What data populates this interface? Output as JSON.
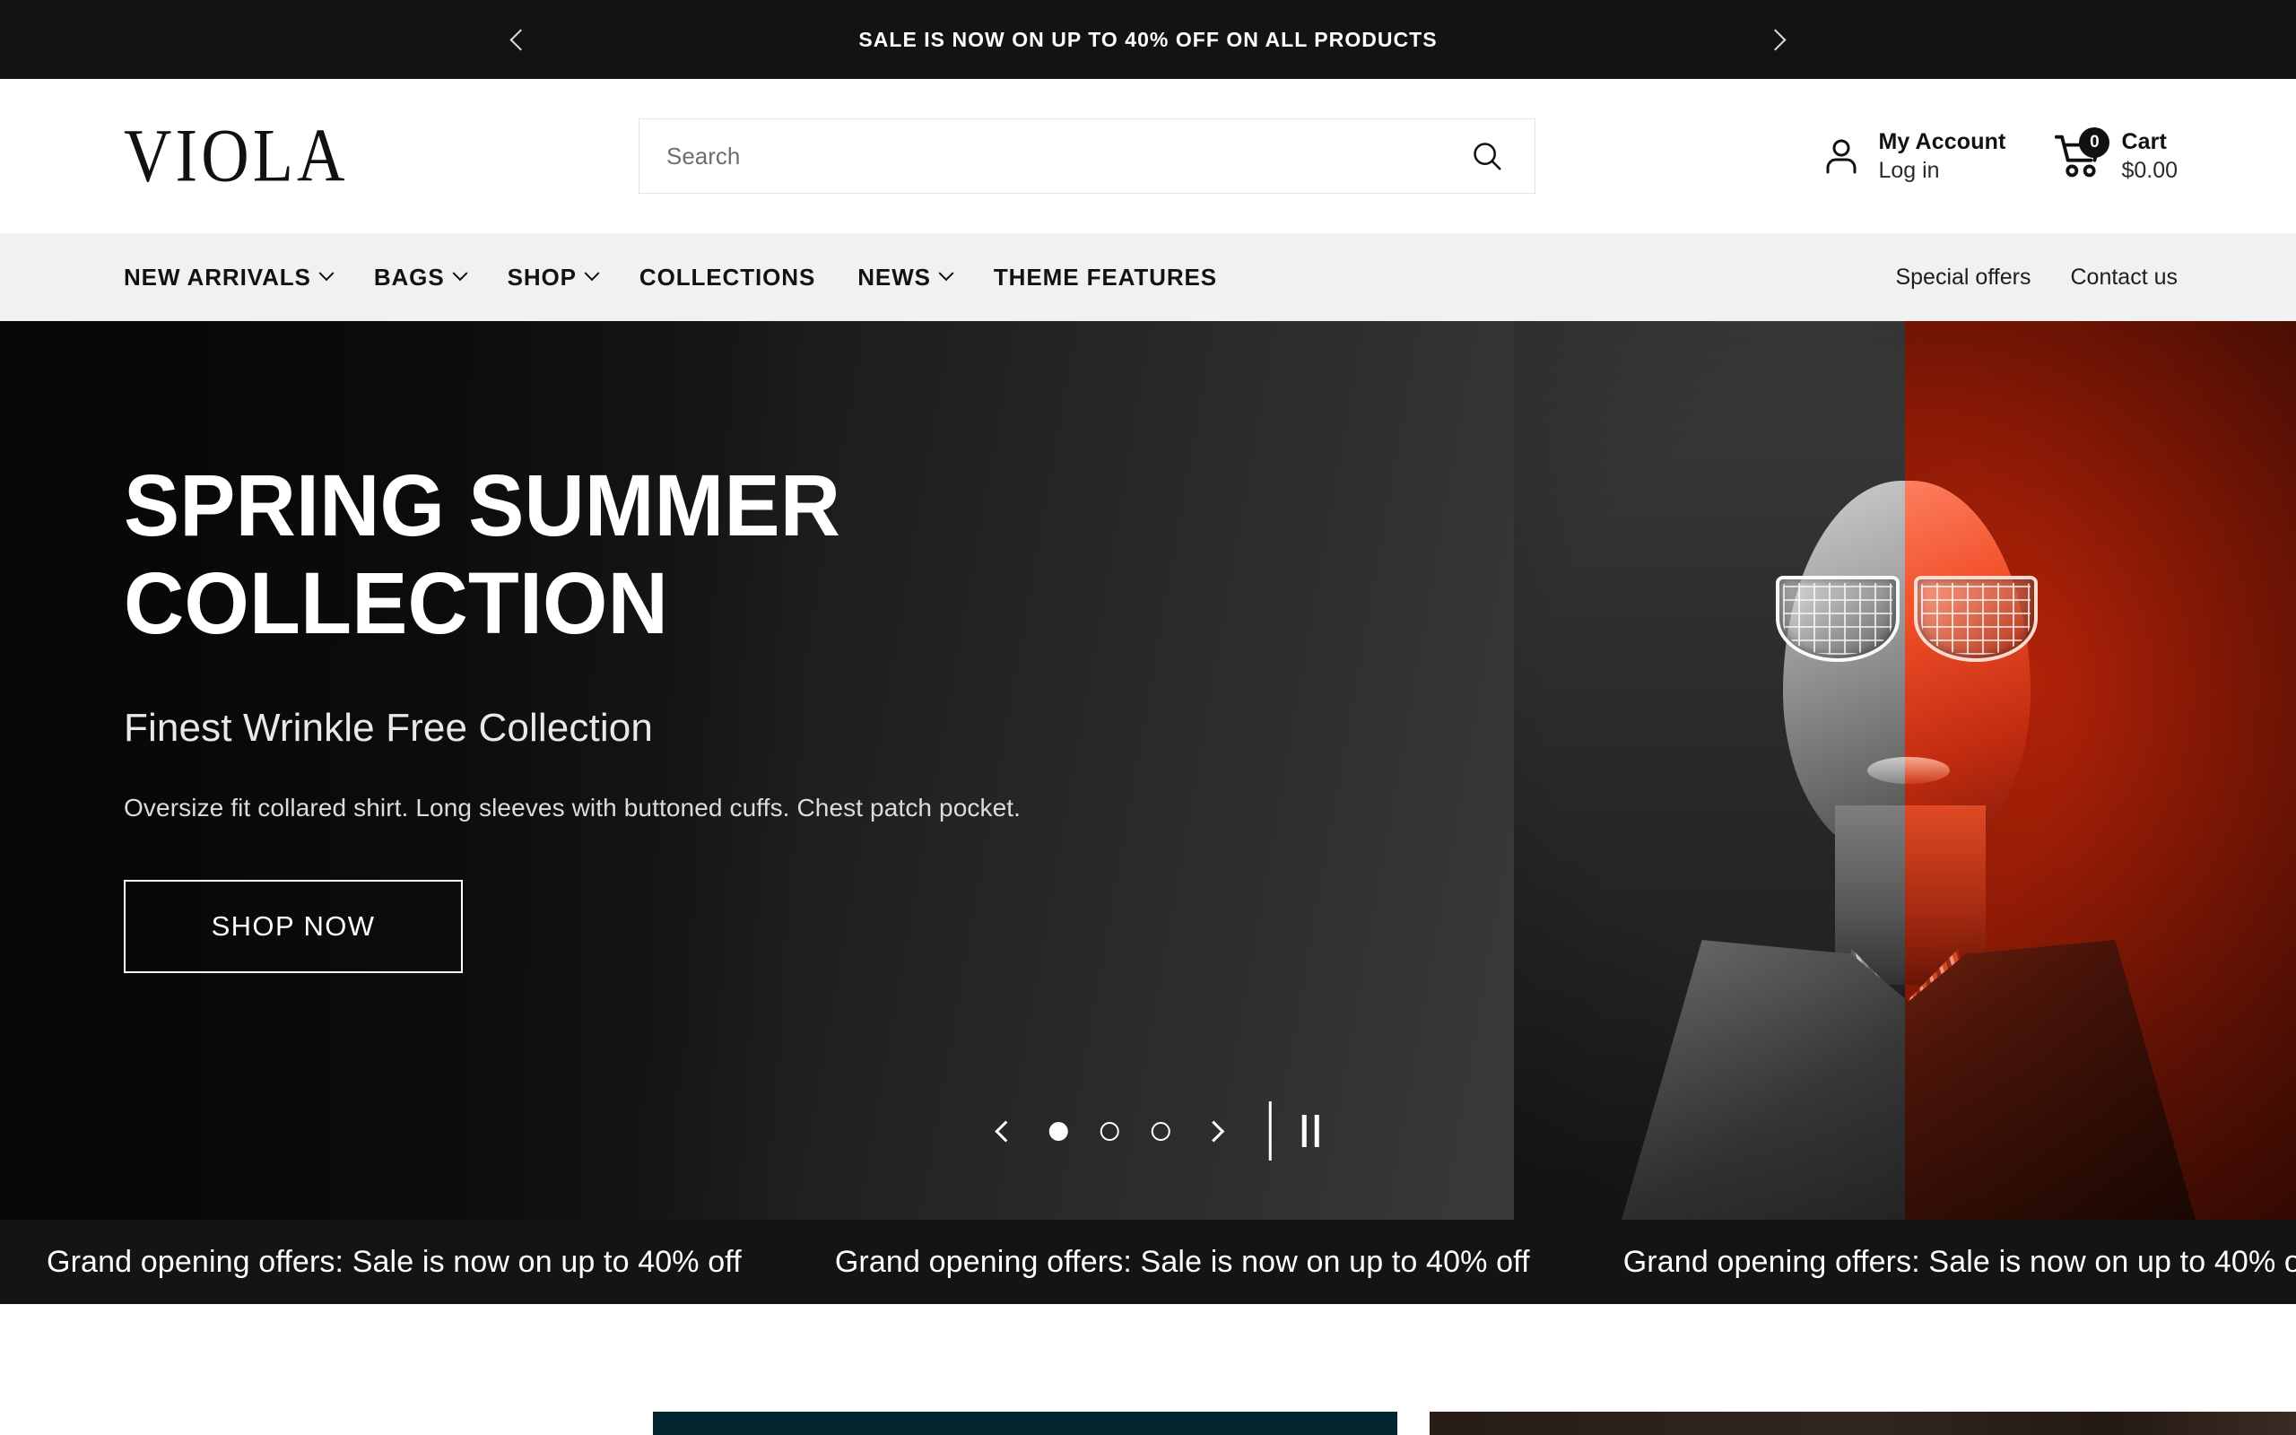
{
  "announcement": {
    "text": "SALE IS NOW ON UP TO 40% OFF ON ALL PRODUCTS",
    "prev_icon": "chevron-left-icon",
    "next_icon": "chevron-right-icon"
  },
  "header": {
    "logo": "VIOLA",
    "search": {
      "placeholder": "Search",
      "value": "",
      "icon": "search-icon"
    },
    "account": {
      "icon": "user-icon",
      "title": "My Account",
      "subtitle": "Log in"
    },
    "cart": {
      "icon": "cart-icon",
      "badge": "0",
      "title": "Cart",
      "subtitle": "$0.00"
    }
  },
  "nav": {
    "items": [
      {
        "label": "NEW ARRIVALS",
        "has_dropdown": true
      },
      {
        "label": "BAGS",
        "has_dropdown": true
      },
      {
        "label": "SHOP",
        "has_dropdown": true
      },
      {
        "label": "COLLECTIONS",
        "has_dropdown": false
      },
      {
        "label": "NEWS",
        "has_dropdown": true
      },
      {
        "label": "THEME FEATURES",
        "has_dropdown": false
      }
    ],
    "links": [
      {
        "label": "Special offers"
      },
      {
        "label": "Contact us"
      }
    ]
  },
  "hero": {
    "title_line1": "SPRING SUMMER",
    "title_line2": "COLLECTION",
    "subtitle": "Finest Wrinkle Free Collection",
    "description": "Oversize fit collared shirt. Long sleeves with buttoned cuffs. Chest patch pocket.",
    "cta": "SHOP NOW",
    "carousel": {
      "slide_count": 3,
      "active_slide": 1,
      "prev_icon": "chevron-left-icon",
      "next_icon": "chevron-right-icon",
      "pause_icon": "pause-icon"
    }
  },
  "marquee": {
    "text": "Grand opening offers: Sale is now on up to 40% off",
    "repeat": 3
  },
  "colors": {
    "announcement_bg": "#131313",
    "nav_bg": "#f1f1f1",
    "marquee_bg": "#141414",
    "hero_accent_red": "#b02208",
    "card_teal": "#03252e",
    "card_brown": "#271d16"
  }
}
